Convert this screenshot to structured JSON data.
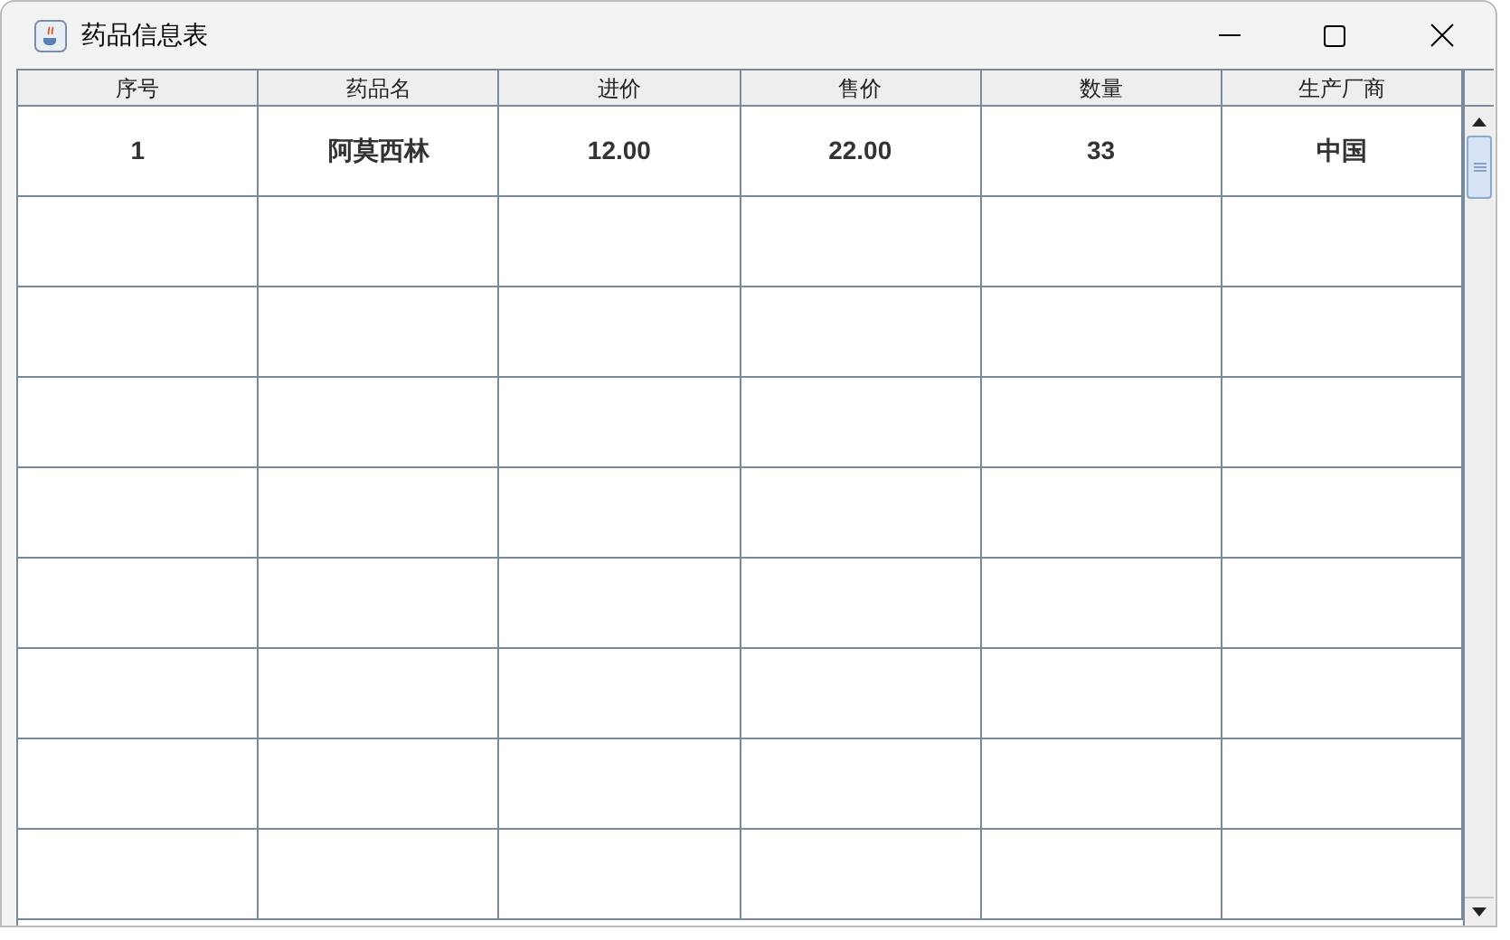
{
  "window": {
    "title": "药品信息表"
  },
  "table": {
    "columns": [
      "序号",
      "药品名",
      "进价",
      "售价",
      "数量",
      "生产厂商"
    ],
    "rows": [
      [
        "1",
        "阿莫西林",
        "12.00",
        "22.00",
        "33",
        "中国"
      ]
    ]
  }
}
